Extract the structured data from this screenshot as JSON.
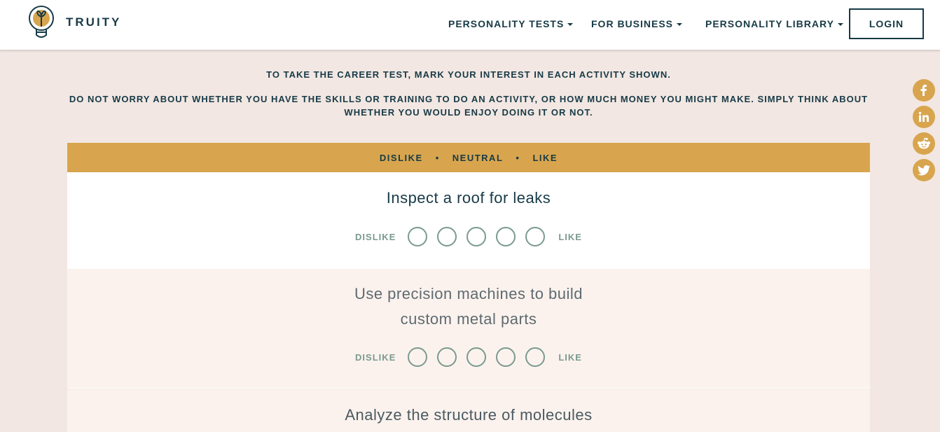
{
  "brand": {
    "name": "TRUITY"
  },
  "nav": {
    "personality_tests": "PERSONALITY TESTS",
    "for_business": "FOR BUSINESS",
    "personality_library": "PERSONALITY LIBRARY",
    "login": "LOGIN"
  },
  "instructions": {
    "line1": "TO TAKE THE CAREER TEST, MARK YOUR INTEREST IN EACH ACTIVITY SHOWN.",
    "line2": "DO NOT WORRY ABOUT WHETHER YOU HAVE THE SKILLS OR TRAINING TO DO AN ACTIVITY, OR HOW MUCH MONEY YOU MIGHT MAKE. SIMPLY THINK ABOUT WHETHER YOU WOULD ENJOY DOING IT OR NOT."
  },
  "scale_header": {
    "dislike": "DISLIKE",
    "neutral": "NEUTRAL",
    "like": "LIKE",
    "separator": "•"
  },
  "scale_labels": {
    "left": "DISLIKE",
    "right": "LIKE"
  },
  "questions": [
    {
      "text": "Inspect a roof for leaks"
    },
    {
      "text": "Use precision machines to build custom metal parts"
    },
    {
      "text": "Analyze the structure of molecules"
    }
  ],
  "social": [
    "facebook-icon",
    "linkedin-icon",
    "reddit-icon",
    "twitter-icon"
  ],
  "colors": {
    "accent": "#d8a54e",
    "navy": "#173a47",
    "page_bg": "#f2e7e2",
    "card_alt_bg": "#fbf2ee",
    "radio_green": "#7b9a8f"
  }
}
